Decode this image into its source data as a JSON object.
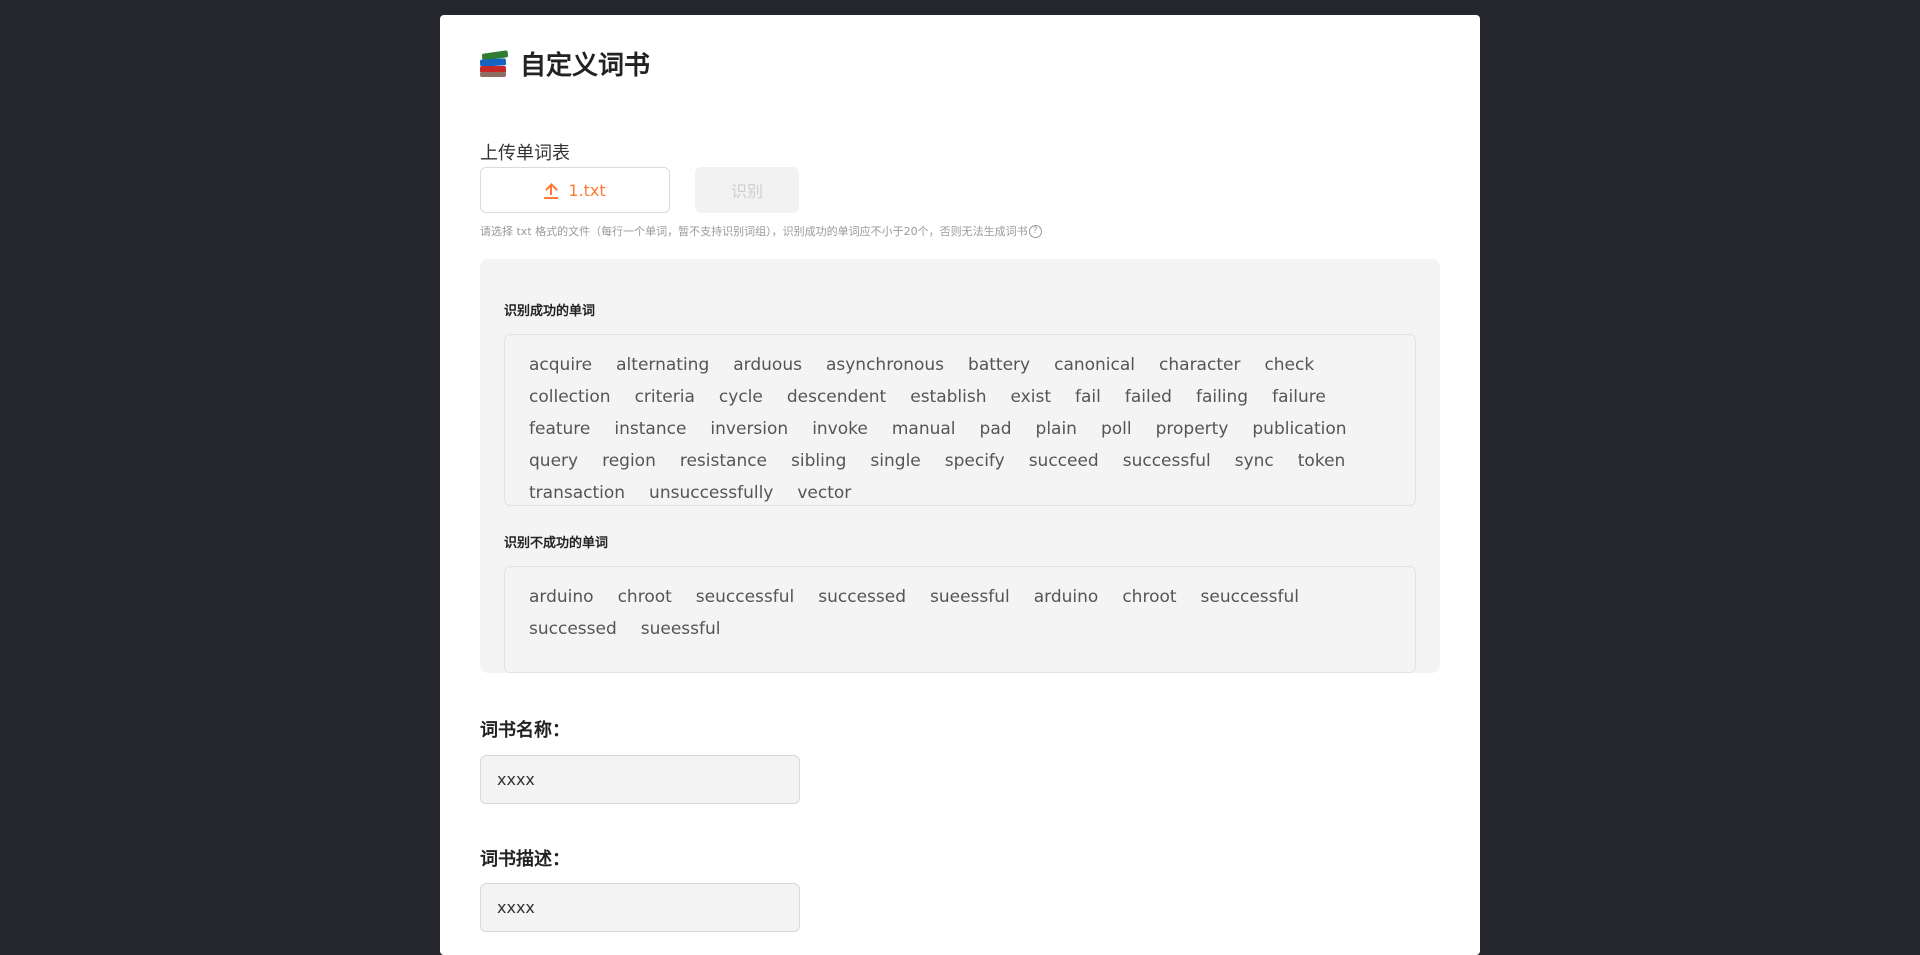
{
  "header": {
    "title": "自定义词书",
    "icon": "books-icon"
  },
  "upload": {
    "section_label": "上传单词表",
    "file_button_label": "1.txt",
    "identify_button_label": "识别",
    "hint": "请选择 txt 格式的文件（每行一个单词，暂不支持识别词组），识别成功的单词应不小于20个，否则无法生成词书",
    "help_icon_glyph": "?"
  },
  "results": {
    "success_heading": "识别成功的单词",
    "success_words": [
      "acquire",
      "alternating",
      "arduous",
      "asynchronous",
      "battery",
      "canonical",
      "character",
      "check",
      "collection",
      "criteria",
      "cycle",
      "descendent",
      "establish",
      "exist",
      "fail",
      "failed",
      "failing",
      "failure",
      "feature",
      "instance",
      "inversion",
      "invoke",
      "manual",
      "pad",
      "plain",
      "poll",
      "property",
      "publication",
      "query",
      "region",
      "resistance",
      "sibling",
      "single",
      "specify",
      "succeed",
      "successful",
      "sync",
      "token",
      "transaction",
      "unsuccessfully",
      "vector"
    ],
    "failed_heading": "识别不成功的单词",
    "failed_words": [
      "arduino",
      "chroot",
      "seuccessful",
      "successed",
      "sueessful",
      "arduino",
      "chroot",
      "seuccessful",
      "successed",
      "sueessful"
    ]
  },
  "form": {
    "name_label": "词书名称：",
    "name_value": "xxxx",
    "desc_label": "词书描述：",
    "desc_value": "xxxx"
  },
  "colors": {
    "page_background": "#25252d",
    "accent": "#ff7a2f"
  }
}
